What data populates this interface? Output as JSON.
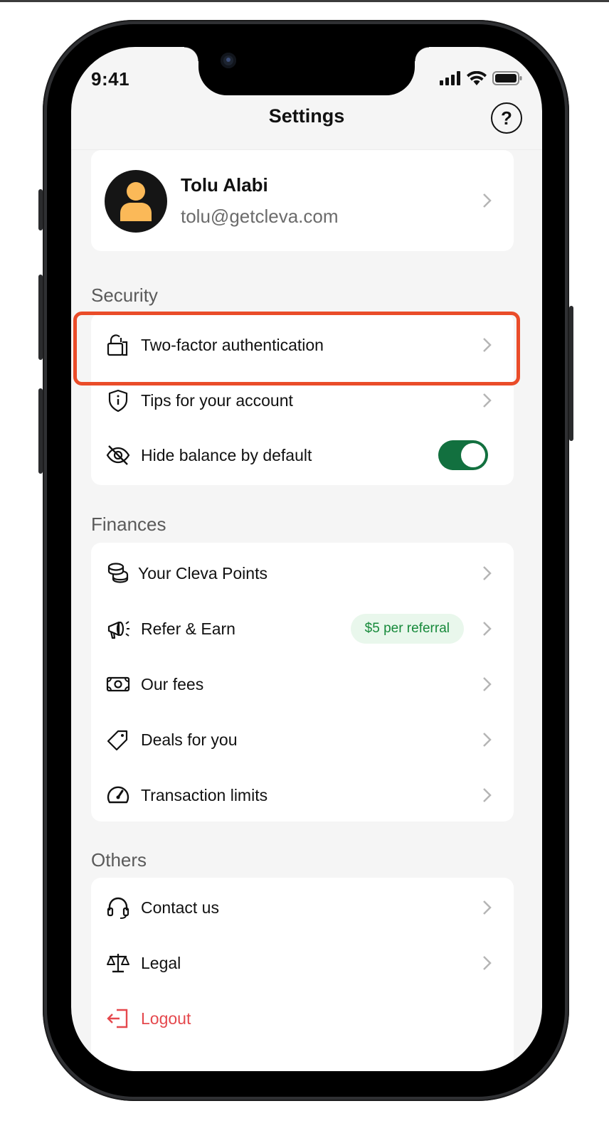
{
  "status_bar": {
    "time": "9:41"
  },
  "header": {
    "title": "Settings",
    "help_label": "?"
  },
  "profile": {
    "name": "Tolu Alabi",
    "email": "tolu@getcleva.com"
  },
  "sections": {
    "security": {
      "title": "Security",
      "items": [
        {
          "label": "Two-factor authentication",
          "icon": "lock-icon"
        },
        {
          "label": "Tips for your account",
          "icon": "shield-icon"
        },
        {
          "label": "Hide balance by default",
          "icon": "eye-off-icon",
          "toggle_on": true
        }
      ]
    },
    "finances": {
      "title": "Finances",
      "items": [
        {
          "label": "Your Cleva Points",
          "icon": "coins-icon"
        },
        {
          "label": "Refer & Earn",
          "icon": "megaphone-icon",
          "badge": "$5 per referral"
        },
        {
          "label": "Our fees",
          "icon": "banknote-icon"
        },
        {
          "label": "Deals for you",
          "icon": "tag-icon"
        },
        {
          "label": "Transaction limits",
          "icon": "gauge-icon"
        }
      ]
    },
    "others": {
      "title": "Others",
      "items": [
        {
          "label": "Contact us",
          "icon": "headset-icon"
        },
        {
          "label": "Legal",
          "icon": "scale-icon"
        },
        {
          "label": "Logout",
          "icon": "logout-icon"
        }
      ]
    }
  },
  "colors": {
    "accent_green": "#12703f",
    "badge_text": "#178a3b",
    "logout_red": "#e5484d",
    "highlight": "#ea4c29",
    "avatar_yellow": "#fbb958"
  }
}
